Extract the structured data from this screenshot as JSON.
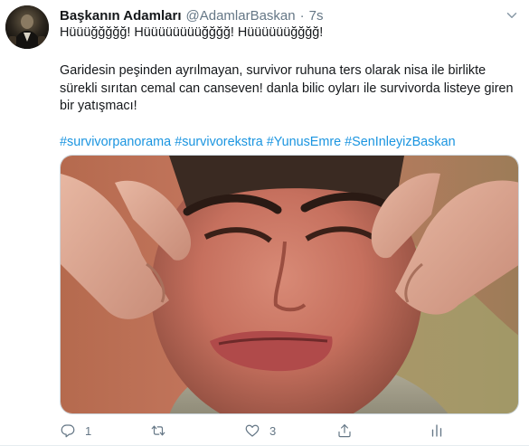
{
  "tweet": {
    "display_name": "Başkanın Adamları",
    "handle": "@AdamlarBaskan",
    "separator": "·",
    "time": "7s",
    "line1": "Hüüüğğğğğ! Hüüüüüüüüğğğğ! Hüüüüüüğğğğ!",
    "paragraph": "Garidesin peşinden ayrılmayan, survivor ruhuna ters olarak nisa ile birlikte sürekli sırıtan cemal can canseven! danla bilic oyları ile survivorda listeye giren bir yatışmacı!",
    "hashtags": [
      "#survivorpanorama",
      "#survivorekstra",
      "#YunusEmre",
      "#SenInleyizBaskan"
    ]
  },
  "actions": {
    "reply_count": "1",
    "retweet_count": "",
    "like_count": "3"
  },
  "icons": {
    "reply": "reply-icon",
    "retweet": "retweet-icon",
    "like": "heart-icon",
    "share": "share-icon",
    "analytics": "analytics-icon",
    "caret": "chevron-down-icon"
  },
  "colors": {
    "link": "#1b95e0",
    "muted": "#657786",
    "text": "#14171a"
  }
}
